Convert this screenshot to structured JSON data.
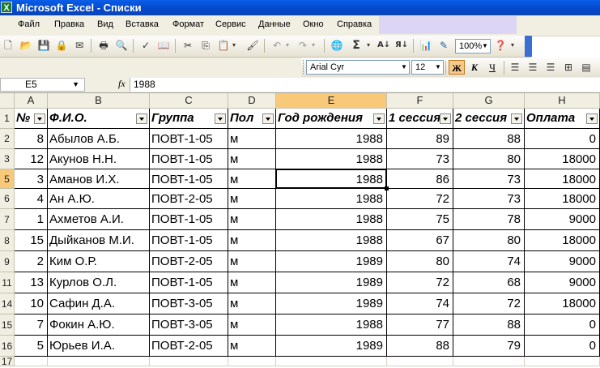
{
  "window": {
    "title": "Microsoft Excel - Списки",
    "app_icon": "X"
  },
  "menu": {
    "items": [
      "Файл",
      "Правка",
      "Вид",
      "Вставка",
      "Формат",
      "Сервис",
      "Данные",
      "Окно",
      "Справка"
    ]
  },
  "toolbar": {
    "zoom": "100%",
    "font_name": "Arial Cyr",
    "font_size": "12",
    "bold_label": "Ж",
    "italic_label": "К",
    "underline_label": "Ч",
    "sigma_label": "Σ"
  },
  "formula_bar": {
    "name_box": "E5",
    "fx_label": "fx",
    "value": "1988"
  },
  "sheet": {
    "columns": [
      "A",
      "B",
      "C",
      "D",
      "E",
      "F",
      "G",
      "H"
    ],
    "selected_column": "E",
    "header_row": [
      "№",
      "Ф.И.О.",
      "Группа",
      "Пол",
      "Год рождения",
      "1 сессия",
      "2 сессия",
      "Оплата"
    ],
    "rows": [
      {
        "num": "2",
        "cells": [
          "8",
          "Абылов А.Б.",
          "ПОВТ-1-05",
          "м",
          "1988",
          "89",
          "88",
          "0"
        ]
      },
      {
        "num": "3",
        "cells": [
          "12",
          "Акунов Н.Н.",
          "ПОВТ-1-05",
          "м",
          "1988",
          "73",
          "80",
          "18000"
        ]
      },
      {
        "num": "5",
        "cells": [
          "3",
          "Аманов И.Х.",
          "ПОВТ-1-05",
          "м",
          "1988",
          "86",
          "73",
          "18000"
        ]
      },
      {
        "num": "6",
        "cells": [
          "4",
          "Ан А.Ю.",
          "ПОВТ-2-05",
          "м",
          "1988",
          "72",
          "73",
          "18000"
        ]
      },
      {
        "num": "7",
        "cells": [
          "1",
          "Ахметов А.И.",
          "ПОВТ-1-05",
          "м",
          "1988",
          "75",
          "78",
          "9000"
        ]
      },
      {
        "num": "8",
        "cells": [
          "15",
          "Дыйканов М.И.",
          "ПОВТ-1-05",
          "м",
          "1988",
          "67",
          "80",
          "18000"
        ]
      },
      {
        "num": "9",
        "cells": [
          "2",
          "Ким О.Р.",
          "ПОВТ-2-05",
          "м",
          "1989",
          "80",
          "74",
          "9000"
        ]
      },
      {
        "num": "11",
        "cells": [
          "13",
          "Курлов О.Л.",
          "ПОВТ-1-05",
          "м",
          "1989",
          "72",
          "68",
          "9000"
        ]
      },
      {
        "num": "14",
        "cells": [
          "10",
          "Сафин Д.А.",
          "ПОВТ-3-05",
          "м",
          "1989",
          "74",
          "72",
          "18000"
        ]
      },
      {
        "num": "15",
        "cells": [
          "7",
          "Фокин А.Ю.",
          "ПОВТ-3-05",
          "м",
          "1988",
          "77",
          "88",
          "0"
        ]
      },
      {
        "num": "16",
        "cells": [
          "5",
          "Юрьев И.А.",
          "ПОВТ-2-05",
          "м",
          "1989",
          "88",
          "79",
          "0"
        ]
      }
    ],
    "last_row_num": "17",
    "active_row_num": "5"
  },
  "colors": {
    "selection": "#f9c97a",
    "titlebar": "#0a5ee8",
    "chrome": "#f1efe2"
  }
}
